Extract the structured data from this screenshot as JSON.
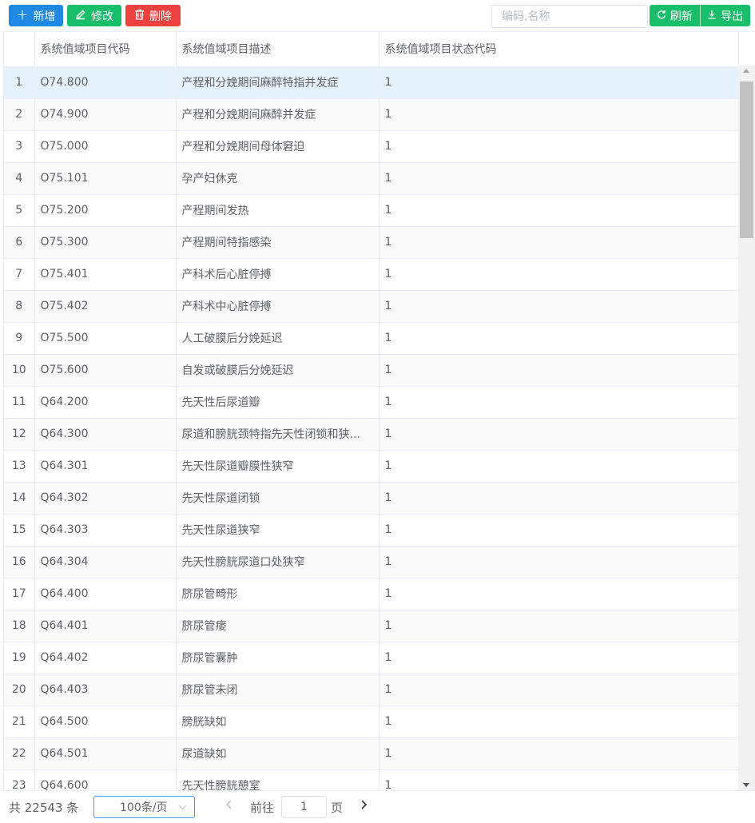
{
  "toolbar": {
    "add_label": "新增",
    "edit_label": "修改",
    "delete_label": "删除",
    "search_placeholder": "编码,名称",
    "refresh_label": "刷新",
    "export_label": "导出"
  },
  "colors": {
    "primary": "#1e88e5",
    "success": "#19be6b",
    "danger": "#ed4040"
  },
  "table": {
    "headers": [
      "",
      "系统值域项目代码",
      "系统值域项目描述",
      "系统值域项目状态代码"
    ],
    "rows": [
      {
        "idx": "1",
        "code": "O74.800",
        "desc": "产程和分娩期间麻醉特指并发症",
        "status": "1"
      },
      {
        "idx": "2",
        "code": "O74.900",
        "desc": "产程和分娩期间麻醉并发症",
        "status": "1"
      },
      {
        "idx": "3",
        "code": "O75.000",
        "desc": "产程和分娩期间母体窘迫",
        "status": "1"
      },
      {
        "idx": "4",
        "code": "O75.101",
        "desc": "孕产妇休克",
        "status": "1"
      },
      {
        "idx": "5",
        "code": "O75.200",
        "desc": "产程期间发热",
        "status": "1"
      },
      {
        "idx": "6",
        "code": "O75.300",
        "desc": "产程期间特指感染",
        "status": "1"
      },
      {
        "idx": "7",
        "code": "O75.401",
        "desc": "产科术后心脏停搏",
        "status": "1"
      },
      {
        "idx": "8",
        "code": "O75.402",
        "desc": "产科术中心脏停搏",
        "status": "1"
      },
      {
        "idx": "9",
        "code": "O75.500",
        "desc": "人工破膜后分娩延迟",
        "status": "1"
      },
      {
        "idx": "10",
        "code": "O75.600",
        "desc": "自发或破膜后分娩延迟",
        "status": "1"
      },
      {
        "idx": "11",
        "code": "Q64.200",
        "desc": "先天性后尿道瓣",
        "status": "1"
      },
      {
        "idx": "12",
        "code": "Q64.300",
        "desc": "尿道和膀胱颈特指先天性闭锁和狭...",
        "status": "1"
      },
      {
        "idx": "13",
        "code": "Q64.301",
        "desc": "先天性尿道瓣膜性狭窄",
        "status": "1"
      },
      {
        "idx": "14",
        "code": "Q64.302",
        "desc": "先天性尿道闭锁",
        "status": "1"
      },
      {
        "idx": "15",
        "code": "Q64.303",
        "desc": "先天性尿道狭窄",
        "status": "1"
      },
      {
        "idx": "16",
        "code": "Q64.304",
        "desc": "先天性膀胱尿道口处狭窄",
        "status": "1"
      },
      {
        "idx": "17",
        "code": "Q64.400",
        "desc": "脐尿管畸形",
        "status": "1"
      },
      {
        "idx": "18",
        "code": "Q64.401",
        "desc": "脐尿管瘘",
        "status": "1"
      },
      {
        "idx": "19",
        "code": "Q64.402",
        "desc": "脐尿管囊肿",
        "status": "1"
      },
      {
        "idx": "20",
        "code": "Q64.403",
        "desc": "脐尿管未闭",
        "status": "1"
      },
      {
        "idx": "21",
        "code": "Q64.500",
        "desc": "膀胱缺如",
        "status": "1"
      },
      {
        "idx": "22",
        "code": "Q64.501",
        "desc": "尿道缺如",
        "status": "1"
      },
      {
        "idx": "23",
        "code": "Q64.600",
        "desc": "先天性膀胱憩室",
        "status": "1"
      }
    ]
  },
  "pagination": {
    "total_text": "共 22543 条",
    "page_size": "100条/页",
    "goto_label": "前往",
    "current_page": "1",
    "page_unit": "页"
  }
}
